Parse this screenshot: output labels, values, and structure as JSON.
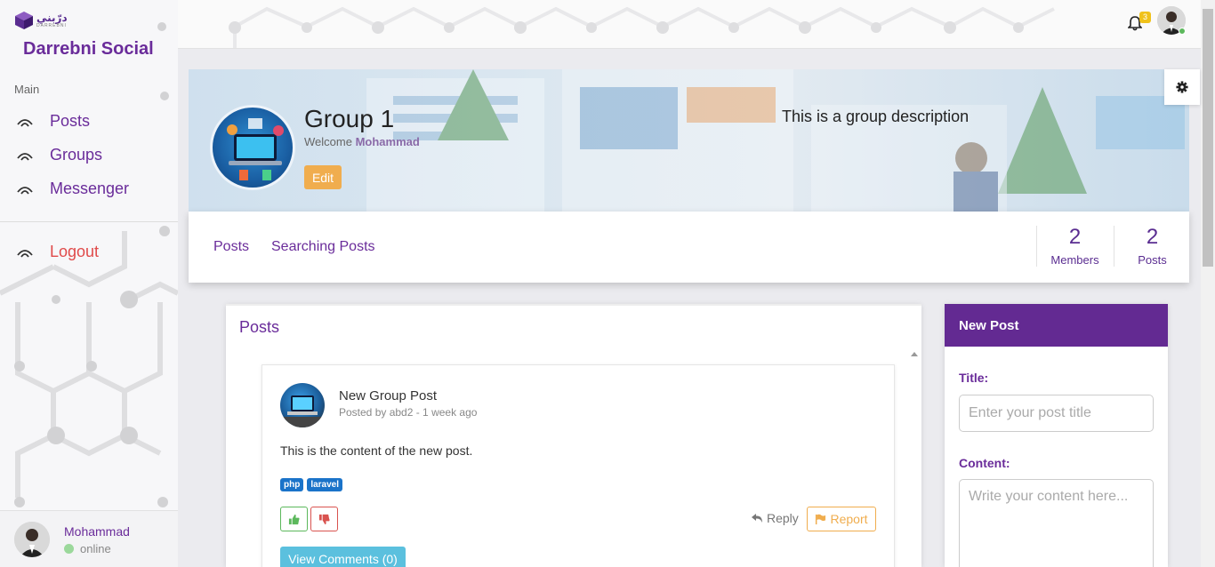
{
  "sidebar": {
    "logo_text": "درّبني",
    "logo_sub": "DARREBNI",
    "brand": "Darrebni Social",
    "section_label": "Main",
    "nav": [
      {
        "label": "Posts"
      },
      {
        "label": "Groups"
      },
      {
        "label": "Messenger"
      }
    ],
    "logout_label": "Logout",
    "user": {
      "name": "Mohammad",
      "status": "online"
    }
  },
  "header": {
    "notification_count": "3"
  },
  "group": {
    "title": "Group 1",
    "welcome_prefix": "Welcome",
    "welcome_name": "Mohammad",
    "edit_label": "Edit",
    "description": "This is a group description"
  },
  "tabs": [
    {
      "label": "Posts"
    },
    {
      "label": "Searching Posts"
    }
  ],
  "stats": [
    {
      "value": "2",
      "label": "Members"
    },
    {
      "value": "2",
      "label": "Posts"
    }
  ],
  "posts_panel": {
    "heading": "Posts",
    "post": {
      "title": "New Group Post",
      "meta": "Posted by abd2 - 1 week ago",
      "content": "This is the content of the new post.",
      "tags": [
        "php",
        "laravel"
      ],
      "reply_label": "Reply",
      "report_label": "Report",
      "comments_label": "View Comments (0)"
    }
  },
  "new_post": {
    "heading": "New Post",
    "title_label": "Title:",
    "title_placeholder": "Enter your post title",
    "content_label": "Content:",
    "content_placeholder": "Write your content here..."
  },
  "colors": {
    "brand_purple": "#632a92",
    "accent_orange": "#f0ad4e",
    "info_blue": "#5bc0de",
    "tag_blue": "#1a73c9",
    "logout_red": "#e04a4a"
  },
  "icons": [
    "wifi-icon",
    "bell-icon",
    "gear-icon",
    "thumbs-up-icon",
    "thumbs-down-icon",
    "reply-icon",
    "flag-icon"
  ]
}
